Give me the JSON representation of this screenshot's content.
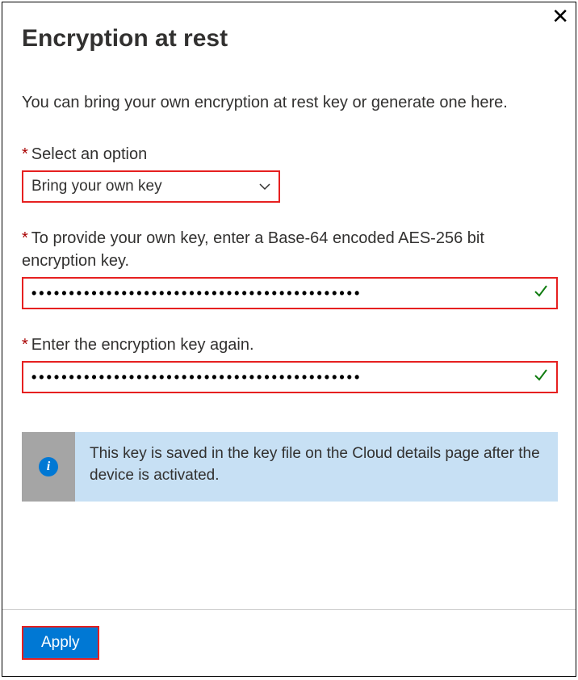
{
  "title": "Encryption at rest",
  "description": "You can bring your own encryption at rest key or generate one here.",
  "fields": {
    "select_option": {
      "label": "Select an option",
      "value": "Bring your own key"
    },
    "key_input": {
      "label": "To provide your own key, enter a Base-64 encoded AES-256 bit encryption key.",
      "masked": "••••••••••••••••••••••••••••••••••••••••••••"
    },
    "key_confirm": {
      "label": "Enter the encryption key again.",
      "masked": "••••••••••••••••••••••••••••••••••••••••••••"
    }
  },
  "info_message": "This key is saved in the key file on the Cloud details page after the device is activated.",
  "apply_label": "Apply",
  "required_mark": "*"
}
